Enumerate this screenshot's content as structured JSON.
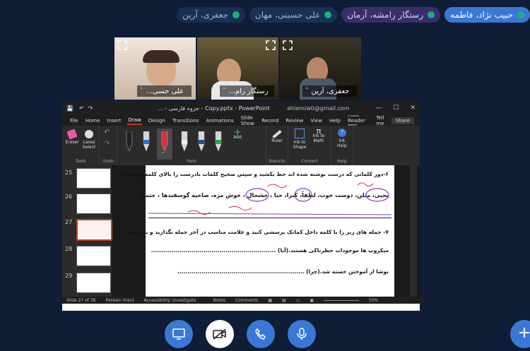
{
  "participants": [
    {
      "name": "حبیب نژاد، فاطمه",
      "style": "active"
    },
    {
      "name": "رستگار رامشه، آرمان",
      "style": "purple"
    },
    {
      "name": "علی حسینی، مهان",
      "style": "dark"
    },
    {
      "name": "جعفری، آرین",
      "style": "dark"
    }
  ],
  "video_tiles": [
    {
      "name": "علی حسی..."
    },
    {
      "name": "رستگار رام..."
    },
    {
      "name": "جعفری، آرین"
    }
  ],
  "ppt": {
    "title": "... - جزوه فارسی - Copy.pptx - PowerPoint",
    "email": "ahlemiw0@gmail.com",
    "menu": [
      "File",
      "Home",
      "Insert",
      "Draw",
      "Design",
      "Transitions",
      "Animations",
      "Slide Show",
      "Record",
      "Review",
      "View",
      "Help",
      "Foxit Reader PDF",
      "Tell me"
    ],
    "selected_menu": "Draw",
    "share": "Share",
    "ribbon": {
      "eraser": "Eraser",
      "lasso": "Lasso Select",
      "tools_group": "Tools",
      "undo_group": "Undo",
      "pens_group": "Pens",
      "add": "Add",
      "stencils_group": "Stencils",
      "ruler": "Ruler",
      "ink_shape": "Ink to Shape",
      "ink_math": "Ink to Math",
      "convert_group": "Convert",
      "ink_help": "Ink Help",
      "help_group": "Help"
    },
    "thumb_numbers": [
      "25",
      "26",
      "27",
      "28",
      "29"
    ],
    "selected_slide": "27",
    "slide": {
      "q6": "۶-دور کلماتی که درست نوشته شده اند خط بکشید و سپس صحیح کلمات نادرست را بالای کلمه بنویسید.",
      "q6_words": "یحیی، مثلن، دوست خوب، لطفاً، کبرا، حنا ، خشحال ، خوش مزه، صاحیه گوسفندها ، حتمن",
      "q7": "۷- جمله های زیر را با کلمه داخل کمانک پرسشی کنید و علامت مناسب در آخر جمله بگذارید و بنویسید.",
      "s1": "میکروب ها موجودات خطرناکی هستند.(آیا) ..............................................................",
      "s2": "نوشا از آموختن خسته شد.(چرا) ..............................................................."
    },
    "status": {
      "slide_count": "Slide 27 of 36",
      "language": "Persian (Iran)",
      "accessibility": "Accessibility: Investigate",
      "notes": "Notes",
      "comments": "Comments",
      "zoom": "50%"
    }
  },
  "colors": {
    "background": "#0f1d36",
    "accent": "#3a78d8",
    "ppt_red": "#c43e1c",
    "ink_red": "#d8313d",
    "ink_purple": "#8a3db6"
  }
}
